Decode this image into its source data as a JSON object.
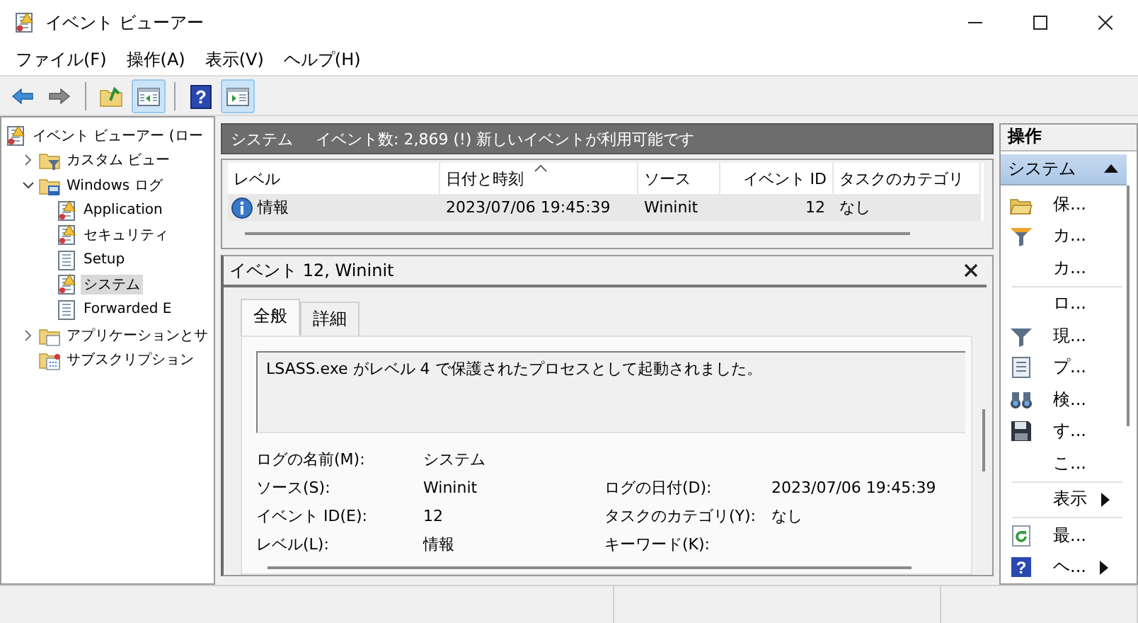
{
  "window": {
    "title": "イベント ビューアー"
  },
  "menu": [
    "ファイル(F)",
    "操作(A)",
    "表示(V)",
    "ヘルプ(H)"
  ],
  "toolbar": [
    {
      "kind": "back",
      "pressed": false
    },
    {
      "kind": "forward",
      "pressed": false
    },
    {
      "kind": "sep"
    },
    {
      "kind": "up",
      "pressed": false
    },
    {
      "kind": "pane-left",
      "pressed": true
    },
    {
      "kind": "sep"
    },
    {
      "kind": "help",
      "label": "?",
      "pressed": false
    },
    {
      "kind": "pane-right",
      "pressed": true
    }
  ],
  "tree": [
    {
      "label": "イベント ビューアー (ロー",
      "kind": "viewer",
      "selected": false,
      "children": [
        {
          "label": "カスタム ビュー",
          "kind": "folder-filter",
          "selected": false,
          "expanded": false
        },
        {
          "label": "Windows ログ",
          "kind": "folder-log",
          "selected": false,
          "expanded": true,
          "children": [
            {
              "label": "Application",
              "kind": "log-warn",
              "selected": false
            },
            {
              "label": "セキュリティ",
              "kind": "log-warn",
              "selected": false
            },
            {
              "label": "Setup",
              "kind": "log",
              "selected": false
            },
            {
              "label": "システム",
              "kind": "log-warn",
              "selected": true
            },
            {
              "label": "Forwarded E",
              "kind": "log",
              "selected": false
            }
          ]
        },
        {
          "label": "アプリケーションとサ",
          "kind": "folder-app",
          "selected": false,
          "expanded": false
        },
        {
          "label": "サブスクリプション",
          "kind": "subscription",
          "selected": false
        }
      ]
    }
  ],
  "header": {
    "title": "システム",
    "info": "イベント数: 2,869 (!) 新しいイベントが利用可能です"
  },
  "table": {
    "columns": [
      {
        "label": "レベル",
        "sorted": false
      },
      {
        "label": "日付と時刻",
        "sorted": true
      },
      {
        "label": "ソース",
        "sorted": false
      },
      {
        "label": "イベント ID",
        "sorted": false
      },
      {
        "label": "タスクのカテゴリ",
        "sorted": false
      }
    ],
    "rows": [
      {
        "kind": "info",
        "cells": [
          "情報",
          "2023/07/06 19:45:39",
          "Wininit",
          "12",
          "なし"
        ],
        "selected": true
      }
    ]
  },
  "detail": {
    "title": "イベント 12, Wininit",
    "tabs": [
      {
        "label": "全般",
        "selected": true
      },
      {
        "label": "詳細",
        "selected": false
      }
    ],
    "message": "LSASS.exe がレベル 4 で保護されたプロセスとして起動されました。",
    "fields": [
      {
        "label": "ログの名前(M):",
        "value": "システム"
      },
      {
        "label": "ソース(S):",
        "value": "Wininit",
        "label_2": "ログの日付(D):",
        "value_2": "2023/07/06 19:45:39"
      },
      {
        "label": "イベント ID(E):",
        "value": "12",
        "label_2": "タスクのカテゴリ(Y):",
        "value_2": "なし"
      },
      {
        "label": "レベル(L):",
        "value": "情報",
        "label_2": "キーワード(K):"
      }
    ]
  },
  "actions": {
    "title": "操作",
    "section": {
      "label": "システム",
      "expanded": true
    },
    "items": [
      {
        "kind": "open",
        "label": "保..."
      },
      {
        "kind": "filter-star",
        "label": "カ..."
      },
      {
        "kind": "none",
        "label": "カ...",
        "divider_after": true
      },
      {
        "kind": "none",
        "label": "ロ..."
      },
      {
        "kind": "filter",
        "label": "現..."
      },
      {
        "kind": "properties",
        "label": "プ..."
      },
      {
        "kind": "find",
        "label": "検..."
      },
      {
        "kind": "save",
        "label": "す..."
      },
      {
        "kind": "none",
        "label": "こ...",
        "divider_after": true
      },
      {
        "kind": "none",
        "label": "表示",
        "submenu": true,
        "divider_after": true
      },
      {
        "kind": "refresh",
        "label": "最..."
      },
      {
        "kind": "help",
        "glyph": "?",
        "label": "ヘ...",
        "submenu": true
      }
    ]
  }
}
